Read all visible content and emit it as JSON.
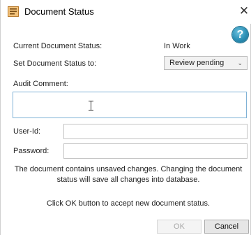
{
  "window": {
    "title": "Document Status",
    "icon": "document-icon",
    "close_glyph": "✕"
  },
  "help": {
    "glyph": "?",
    "icon": "help-icon",
    "color": "#2b8fb5"
  },
  "current_status": {
    "label": "Current Document Status:",
    "value": "In Work"
  },
  "set_status": {
    "label": "Set Document Status to:",
    "selected": "Review pending"
  },
  "audit_comment": {
    "label": "Audit Comment:",
    "value": ""
  },
  "user_id": {
    "label": "User-Id:",
    "value": ""
  },
  "password": {
    "label": "Password:",
    "value": ""
  },
  "messages": {
    "warning": "The document contains unsaved changes. Changing the document status will save all changes into database.",
    "instruction": "Click OK button to accept new document status."
  },
  "buttons": {
    "ok": "OK",
    "cancel": "Cancel"
  }
}
